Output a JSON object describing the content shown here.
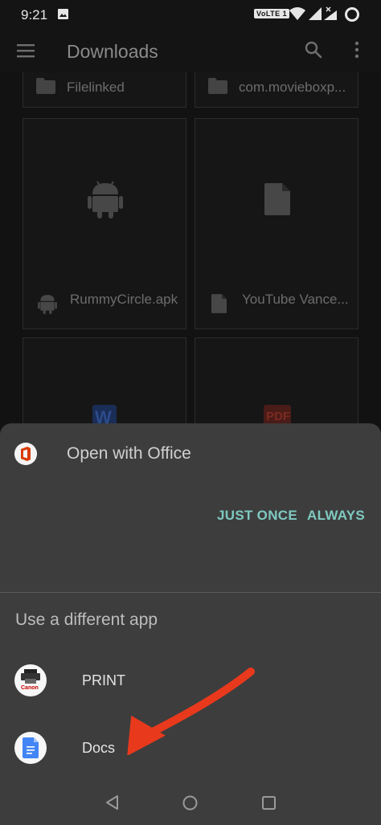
{
  "status_bar": {
    "time": "9:21",
    "network_badge": "VoLTE 1",
    "icons": [
      "image-icon",
      "wifi-icon",
      "signal-icon",
      "signal-no-data-icon",
      "battery-icon"
    ]
  },
  "app_bar": {
    "title": "Downloads",
    "icons": [
      "menu-icon",
      "search-icon",
      "overflow-menu-icon"
    ]
  },
  "files": {
    "folders": [
      {
        "name": "Filelinked",
        "icon": "folder-icon"
      },
      {
        "name": "com.movieboxp...",
        "icon": "folder-icon"
      }
    ],
    "items": [
      {
        "name": "RummyCircle.apk",
        "icon": "android-icon"
      },
      {
        "name": "YouTube Vance...",
        "icon": "document-icon"
      },
      {
        "name": "",
        "icon": "word-document-icon",
        "thumb_text": "W"
      },
      {
        "name": "",
        "icon": "pdf-document-icon",
        "thumb_text": "PDF"
      }
    ]
  },
  "chooser": {
    "title": "Open with Office",
    "icon": "office-logo-icon",
    "just_once_label": "JUST ONCE",
    "always_label": "ALWAYS",
    "section_label": "Use a different app",
    "apps": [
      {
        "label": "PRINT",
        "icon": "canon-print-icon",
        "icon_caption": "Canon"
      },
      {
        "label": "Docs",
        "icon": "google-docs-icon"
      }
    ],
    "accent_color": "#7fc9c0",
    "annotation": "red-arrow-pointing-to-docs"
  },
  "nav_bar": {
    "icons": [
      "back-icon",
      "home-icon",
      "recents-icon"
    ]
  }
}
